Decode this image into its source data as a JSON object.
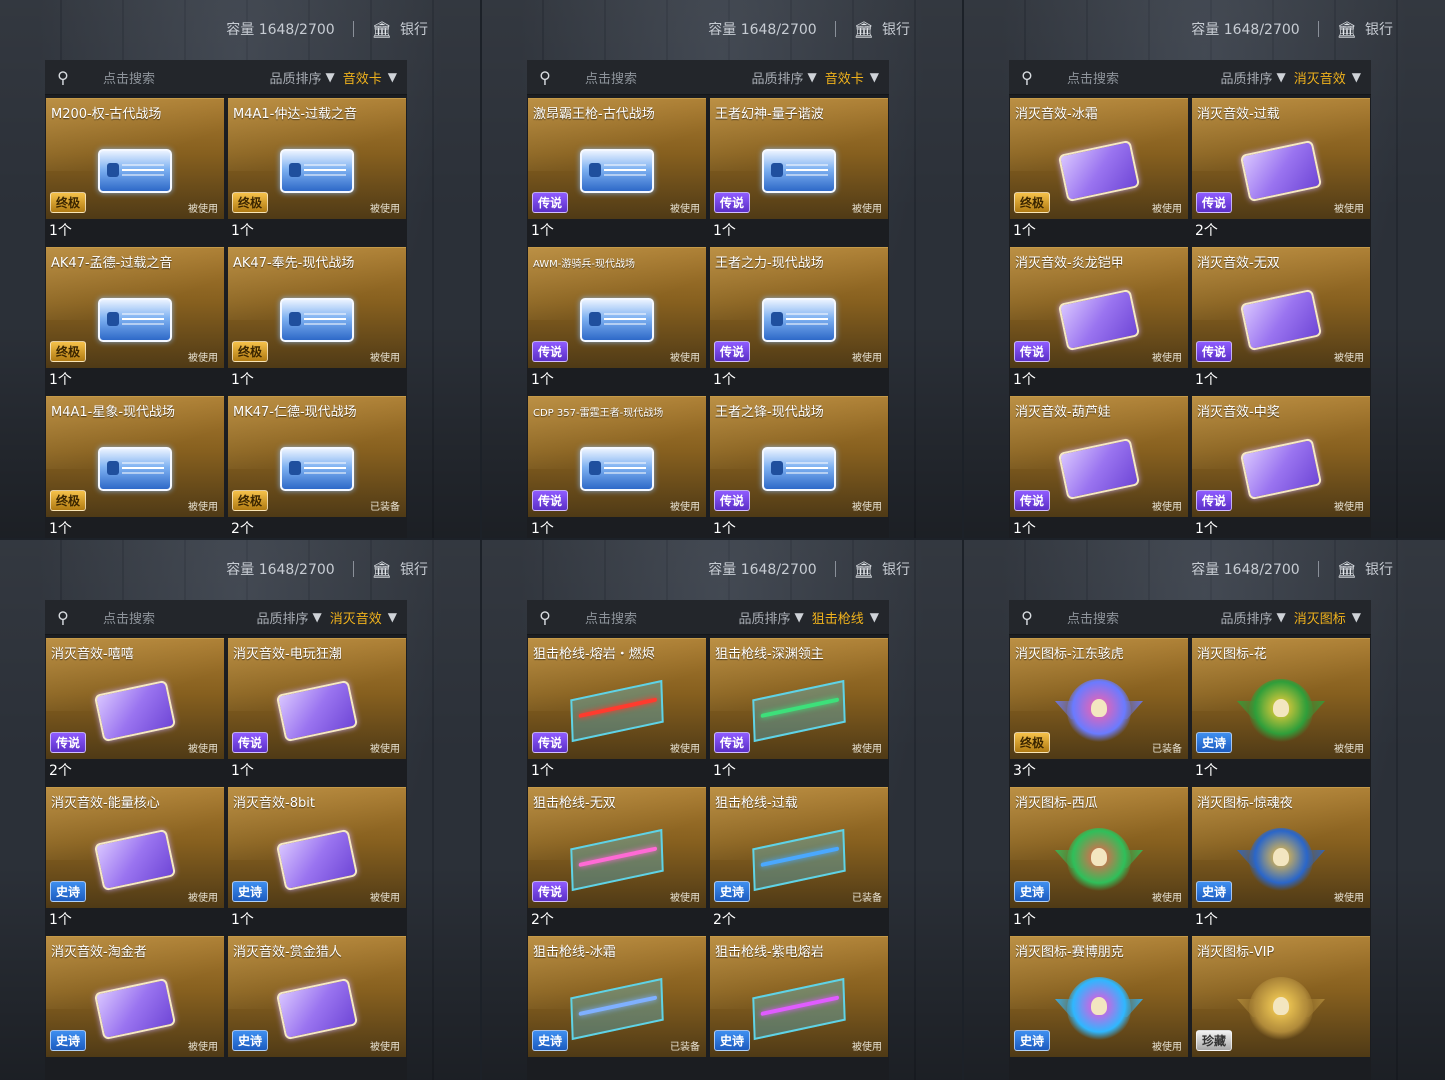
{
  "screenshots": [
    {
      "capacity": "容量 1648/2700",
      "bank": "银行",
      "search_placeholder": "点击搜索",
      "sort_label": "品质排序",
      "category": "音效卡",
      "items": [
        {
          "name": "M200-权-古代战场",
          "rarity": "终极",
          "status": "被使用",
          "count": "1个",
          "art": "sound"
        },
        {
          "name": "M4A1-仲达-过载之音",
          "rarity": "终极",
          "status": "被使用",
          "count": "1个",
          "art": "sound"
        },
        {
          "name": "AK47-孟德-过载之音",
          "rarity": "终极",
          "status": "被使用",
          "count": "1个",
          "art": "sound"
        },
        {
          "name": "AK47-奉先-现代战场",
          "rarity": "终极",
          "status": "被使用",
          "count": "1个",
          "art": "sound"
        },
        {
          "name": "M4A1-星象-现代战场",
          "rarity": "终极",
          "status": "被使用",
          "count": "1个",
          "art": "sound"
        },
        {
          "name": "MK47-仁德-现代战场",
          "rarity": "终极",
          "status": "已装备",
          "count": "2个",
          "art": "sound"
        }
      ]
    },
    {
      "capacity": "容量 1648/2700",
      "bank": "银行",
      "search_placeholder": "点击搜索",
      "sort_label": "品质排序",
      "category": "音效卡",
      "items": [
        {
          "name": "激昂霸王枪-古代战场",
          "rarity": "传说",
          "status": "被使用",
          "count": "1个",
          "art": "sound"
        },
        {
          "name": "王者幻神-量子谐波",
          "rarity": "传说",
          "status": "被使用",
          "count": "1个",
          "art": "sound"
        },
        {
          "name": "AWM-游骑兵-现代战场",
          "rarity": "传说",
          "status": "被使用",
          "count": "1个",
          "art": "sound",
          "small": true
        },
        {
          "name": "王者之力-现代战场",
          "rarity": "传说",
          "status": "被使用",
          "count": "1个",
          "art": "sound"
        },
        {
          "name": "CDP 357-雷霆王者-现代战场",
          "rarity": "传说",
          "status": "被使用",
          "count": "1个",
          "art": "sound",
          "small": true
        },
        {
          "name": "王者之锋-现代战场",
          "rarity": "传说",
          "status": "被使用",
          "count": "1个",
          "art": "sound"
        }
      ]
    },
    {
      "capacity": "容量 1648/2700",
      "bank": "银行",
      "search_placeholder": "点击搜索",
      "sort_label": "品质排序",
      "category": "消灭音效",
      "items": [
        {
          "name": "消灭音效-冰霜",
          "rarity": "终极",
          "status": "被使用",
          "count": "1个",
          "art": "elim"
        },
        {
          "name": "消灭音效-过载",
          "rarity": "传说",
          "status": "被使用",
          "count": "2个",
          "art": "elim"
        },
        {
          "name": "消灭音效-炎龙铠甲",
          "rarity": "传说",
          "status": "被使用",
          "count": "1个",
          "art": "elim"
        },
        {
          "name": "消灭音效-无双",
          "rarity": "传说",
          "status": "被使用",
          "count": "1个",
          "art": "elim"
        },
        {
          "name": "消灭音效-葫芦娃",
          "rarity": "传说",
          "status": "被使用",
          "count": "1个",
          "art": "elim"
        },
        {
          "name": "消灭音效-中奖",
          "rarity": "传说",
          "status": "被使用",
          "count": "1个",
          "art": "elim"
        }
      ]
    },
    {
      "capacity": "容量 1648/2700",
      "bank": "银行",
      "search_placeholder": "点击搜索",
      "sort_label": "品质排序",
      "category": "消灭音效",
      "items": [
        {
          "name": "消灭音效-嘻嘻",
          "rarity": "传说",
          "status": "被使用",
          "count": "2个",
          "art": "elim"
        },
        {
          "name": "消灭音效-电玩狂潮",
          "rarity": "传说",
          "status": "被使用",
          "count": "1个",
          "art": "elim"
        },
        {
          "name": "消灭音效-能量核心",
          "rarity": "史诗",
          "status": "被使用",
          "count": "1个",
          "art": "elim"
        },
        {
          "name": "消灭音效-8bit",
          "rarity": "史诗",
          "status": "被使用",
          "count": "1个",
          "art": "elim"
        },
        {
          "name": "消灭音效-淘金者",
          "rarity": "史诗",
          "status": "被使用",
          "count": "",
          "art": "elim"
        },
        {
          "name": "消灭音效-赏金猎人",
          "rarity": "史诗",
          "status": "被使用",
          "count": "",
          "art": "elim"
        }
      ]
    },
    {
      "capacity": "容量 1648/2700",
      "bank": "银行",
      "search_placeholder": "点击搜索",
      "sort_label": "品质排序",
      "category": "狙击枪线",
      "items": [
        {
          "name": "狙击枪线-熔岩・燃烬",
          "rarity": "传说",
          "status": "被使用",
          "count": "1个",
          "art": "sniper",
          "beam": "#ff3b2e"
        },
        {
          "name": "狙击枪线-深渊领主",
          "rarity": "传说",
          "status": "被使用",
          "count": "1个",
          "art": "sniper",
          "beam": "#3de07a"
        },
        {
          "name": "狙击枪线-无双",
          "rarity": "传说",
          "status": "被使用",
          "count": "2个",
          "art": "sniper",
          "beam": "#ff6ad5"
        },
        {
          "name": "狙击枪线-过载",
          "rarity": "史诗",
          "status": "已装备",
          "count": "2个",
          "art": "sniper",
          "beam": "#4aa8ff"
        },
        {
          "name": "狙击枪线-冰霜",
          "rarity": "史诗",
          "status": "已装备",
          "count": "",
          "art": "sniper",
          "beam": "#7fb0ff"
        },
        {
          "name": "狙击枪线-紫电熔岩",
          "rarity": "史诗",
          "status": "被使用",
          "count": "",
          "art": "sniper",
          "beam": "#e05cff"
        }
      ]
    },
    {
      "capacity": "容量 1648/2700",
      "bank": "银行",
      "search_placeholder": "点击搜索",
      "sort_label": "品质排序",
      "category": "消灭图标",
      "items": [
        {
          "name": "消灭图标-江东骇虎",
          "rarity": "终极",
          "status": "已装备",
          "count": "3个",
          "art": "emblem",
          "c1": "#ff5fa8",
          "c2": "#6a7bff"
        },
        {
          "name": "消灭图标-花",
          "rarity": "史诗",
          "status": "被使用",
          "count": "1个",
          "art": "emblem",
          "c1": "#ffd23a",
          "c2": "#2f9e3a"
        },
        {
          "name": "消灭图标-西瓜",
          "rarity": "史诗",
          "status": "被使用",
          "count": "1个",
          "art": "emblem",
          "c1": "#ff5a4a",
          "c2": "#2fbf5a"
        },
        {
          "name": "消灭图标-惊魂夜",
          "rarity": "史诗",
          "status": "被使用",
          "count": "1个",
          "art": "emblem",
          "c1": "#ffc73a",
          "c2": "#2a66c9"
        },
        {
          "name": "消灭图标-赛博朋克",
          "rarity": "史诗",
          "status": "被使用",
          "count": "",
          "art": "emblem",
          "c1": "#ff4ad8",
          "c2": "#2fb7ff"
        },
        {
          "name": "消灭图标-VIP",
          "rarity": "珍藏",
          "status": "",
          "count": "",
          "art": "emblem",
          "c1": "#ffd75a",
          "c2": "#b08a3a"
        }
      ]
    }
  ]
}
